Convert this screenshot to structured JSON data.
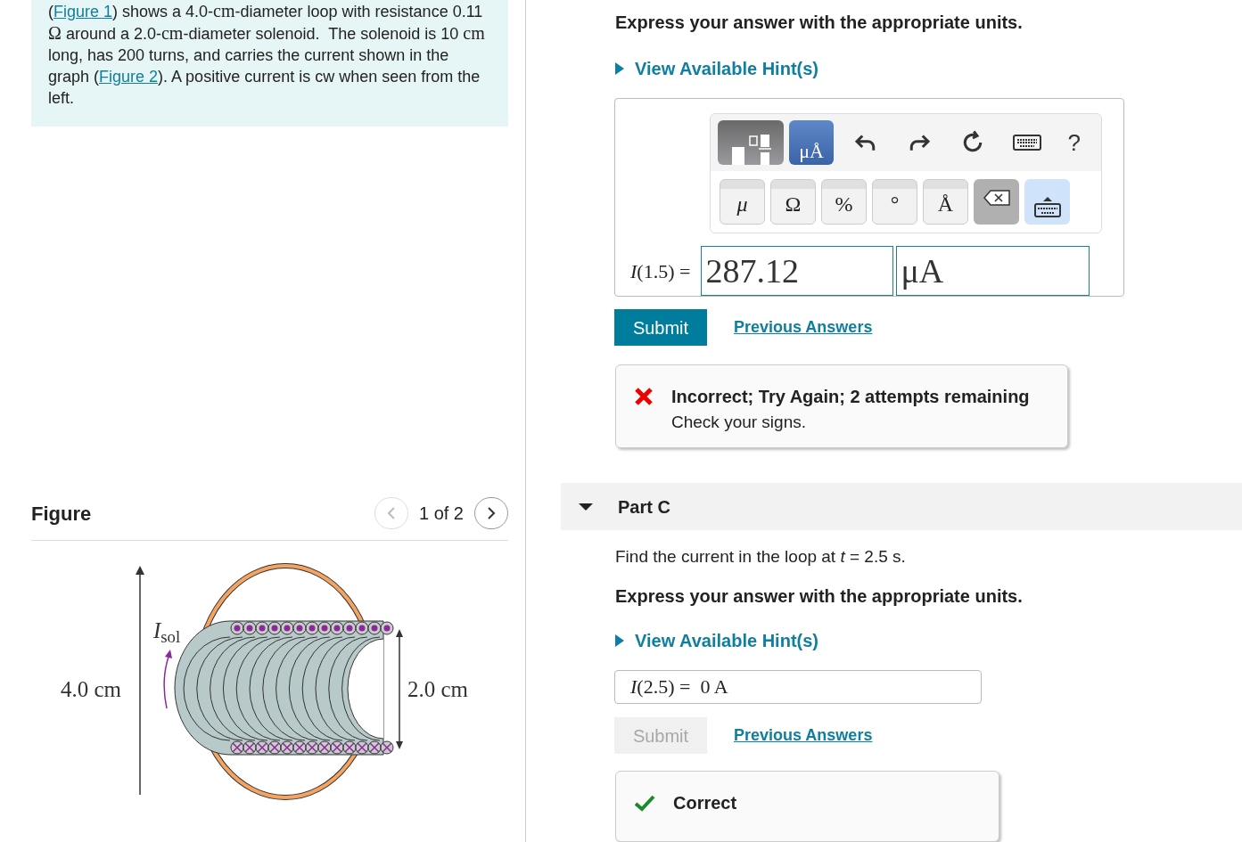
{
  "problem": {
    "segments": [
      {
        "kind": "text",
        "text": "("
      },
      {
        "kind": "link",
        "text": "Figure 1"
      },
      {
        "kind": "text",
        "text": ") shows a 4.0-"
      },
      {
        "kind": "math",
        "text": "cm"
      },
      {
        "kind": "text",
        "text": "-diameter loop with resistance 0.11 "
      },
      {
        "kind": "math",
        "text": "Ω"
      },
      {
        "kind": "text",
        "text": " around a 2.0-"
      },
      {
        "kind": "math",
        "text": "cm"
      },
      {
        "kind": "text",
        "text": "-diameter solenoid.  The solenoid is 10 "
      },
      {
        "kind": "math",
        "text": "cm"
      },
      {
        "kind": "text",
        "text": " long, has 200 turns, and carries the current shown in the graph ("
      },
      {
        "kind": "link",
        "text": "Figure 2"
      },
      {
        "kind": "text",
        "text": "). A positive current is cw when seen from the left."
      }
    ]
  },
  "figure": {
    "title": "Figure",
    "pager": "1 of 2",
    "prev_disabled": true,
    "next_disabled": false,
    "labels": {
      "loop_diameter": "4.0 cm",
      "current": "*I*$_{sol}$",
      "solenoid_diameter": "2.0 cm"
    }
  },
  "part_b": {
    "units_note": "Express your answer with the appropriate units.",
    "hint": "View Available Hint(s)",
    "toolbar": [
      {
        "kind": "templates",
        "selected": false
      },
      {
        "kind": "units",
        "label": "μÅ",
        "selected": true
      }
    ],
    "tools": [
      {
        "kind": "undo"
      },
      {
        "kind": "redo"
      },
      {
        "kind": "reset"
      },
      {
        "kind": "keyboard"
      },
      {
        "kind": "help",
        "label": "?"
      }
    ],
    "keys": [
      {
        "kind": "symbol",
        "label": "μ",
        "italic": true
      },
      {
        "kind": "symbol",
        "label": "Ω",
        "italic": false
      },
      {
        "kind": "symbol",
        "label": "%",
        "italic": false
      },
      {
        "kind": "symbol",
        "label": "°",
        "italic": false
      },
      {
        "kind": "symbol",
        "label": "Å",
        "italic": false
      },
      {
        "kind": "backspace"
      },
      {
        "kind": "keyboard"
      }
    ],
    "answer_label": "*I*(1.5) =",
    "value": "287.12",
    "unit": "μA",
    "submit": {
      "label": "Submit",
      "disabled": false
    },
    "previous": "Previous Answers",
    "feedback": {
      "correct": false,
      "title": "Incorrect; Try Again; 2 attempts remaining",
      "message": "Check your signs."
    }
  },
  "part_c": {
    "title": "Part C",
    "expanded": true,
    "question": "Find the current in the loop at *t* = 2.5 s.",
    "units_note": "Express your answer with the appropriate units.",
    "hint": "View Available Hint(s)",
    "answer": "*I*(2.5) =  0 A",
    "submit": {
      "label": "Submit",
      "disabled": true
    },
    "previous": "Previous Answers",
    "feedback": {
      "correct": true,
      "title": "Correct"
    }
  }
}
